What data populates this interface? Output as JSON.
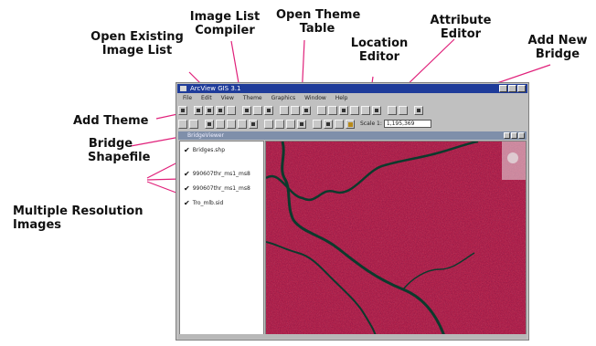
{
  "callouts": {
    "open_existing_image_list": "Open Existing\nImage List",
    "image_list_compiler": "Image List\nCompiler",
    "open_theme_table": "Open Theme\nTable",
    "location_editor": "Location\nEditor",
    "attribute_editor": "Attribute\nEditor",
    "add_new_bridge": "Add New\nBridge",
    "add_theme": "Add Theme",
    "bridge_shapefile": "Bridge\nShapefile",
    "multiple_resolution_images": "Multiple Resolution\nImages"
  },
  "app": {
    "title": "ArcView GIS 3.1",
    "menu": [
      "File",
      "Edit",
      "View",
      "Theme",
      "Graphics",
      "Window",
      "Help"
    ],
    "view_title": "BridgeViewer",
    "scale_label": "Scale 1:",
    "scale_value": "1,195,369"
  },
  "toc": {
    "items": [
      {
        "label": "Bridges.shp",
        "checked": true
      },
      {
        "label": "990607thr_ms1_ms8",
        "checked": true
      },
      {
        "label": "990607thr_ms1_ms8",
        "checked": true
      },
      {
        "label": "Tro_mlb.sid",
        "checked": true
      }
    ]
  },
  "colors": {
    "map_base": "#c2274f",
    "river": "#0c3a2c",
    "titlebar": "#1f3c9a",
    "callout_line": "#e0207a"
  }
}
